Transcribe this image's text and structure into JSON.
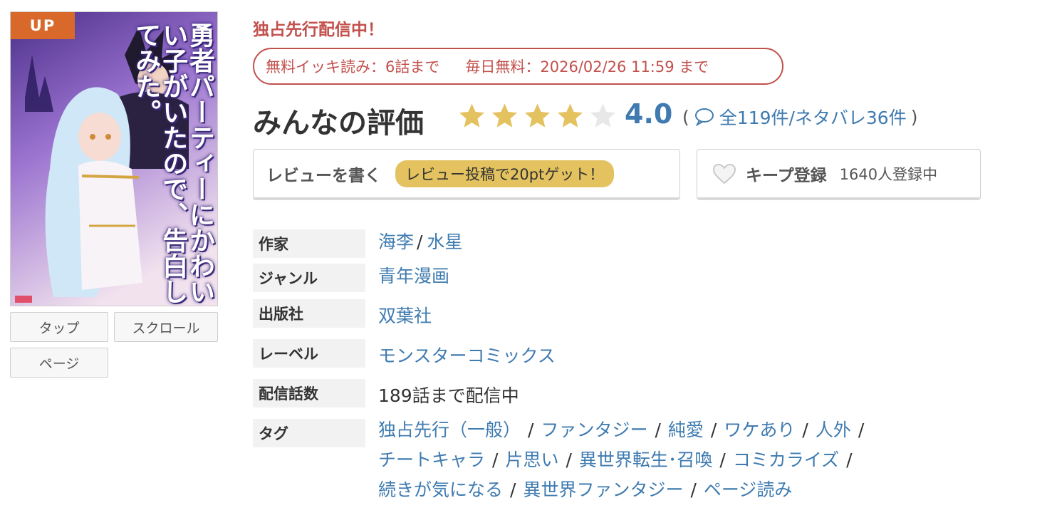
{
  "cover": {
    "badge": "UP",
    "title_art": "勇者パーティーにかわいい子がいたので、告白してみた。"
  },
  "view_modes": [
    "タップ",
    "スクロール",
    "ページ"
  ],
  "exclusive": "独占先行配信中！",
  "free_info": {
    "ikki": "無料イッキ読み：6話まで",
    "daily": "毎日無料：2026/02/26 11:59 まで"
  },
  "rating": {
    "label": "みんなの評価",
    "score": "4.0",
    "stars_filled": 4,
    "stars_total": 5,
    "paren_open": "(",
    "paren_close": ")",
    "reviews": "全119件/ネタバレ36件",
    "star_color": "#e3c25f",
    "star_empty_color": "#e8e8e8"
  },
  "review_button": {
    "label": "レビューを書く",
    "badge": "レビュー投稿で20ptゲット！"
  },
  "keep_button": {
    "label": "キープ登録",
    "count": "1640人登録中"
  },
  "info": {
    "author": {
      "label": "作家",
      "values": [
        "海李",
        "水星"
      ],
      "separator": "/"
    },
    "genre": {
      "label": "ジャンル",
      "value": "青年漫画"
    },
    "publisher": {
      "label": "出版社",
      "value": "双葉社"
    },
    "imprint": {
      "label": "レーベル",
      "value": "モンスターコミックス"
    },
    "episodes": {
      "label": "配信話数",
      "value": "189話まで配信中"
    },
    "tags": {
      "label": "タグ",
      "items": [
        "独占先行（一般）",
        "ファンタジー",
        "純愛",
        "ワケあり",
        "人外",
        "チートキャラ",
        "片思い",
        "異世界転生･召喚",
        "コミカライズ",
        "続きが気になる",
        "異世界ファンタジー",
        "ページ読み"
      ],
      "separator": "/"
    }
  },
  "colors": {
    "accent_red": "#c2504c",
    "link_blue": "#3f7bb0",
    "badge_orange": "#d9692a",
    "badge_gold": "#e3c25f"
  }
}
